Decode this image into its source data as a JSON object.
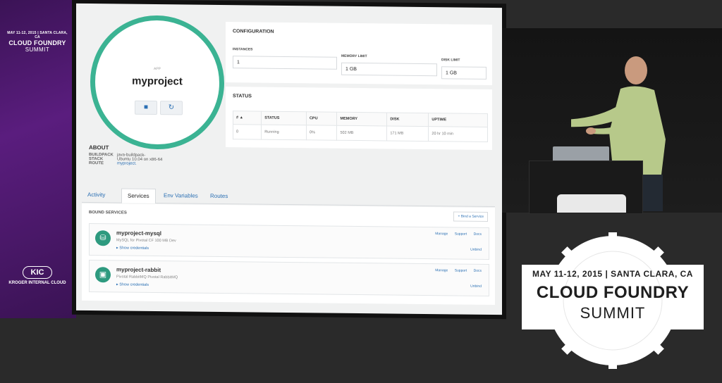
{
  "banner": {
    "date": "MAY 11-12, 2015 | SANTA CLARA, CA",
    "brand": "CLOUD FOUNDRY",
    "event": "SUMMIT",
    "kic_mark": "KIC",
    "kic_name": "KROGER INTERNAL CLOUD"
  },
  "app": {
    "label": "APP",
    "name": "myproject"
  },
  "about": {
    "heading": "ABOUT",
    "buildpack_label": "BUILDPACK",
    "buildpack_value": "java-buildpack-",
    "stack_label": "STACK",
    "stack_value": "Ubuntu 10.04 on x86-64",
    "route_label": "ROUTE",
    "route_value": "myproject."
  },
  "configuration": {
    "heading": "CONFIGURATION",
    "instances_label": "INSTANCES",
    "instances_value": "1",
    "memory_label": "MEMORY LIMIT",
    "memory_value": "1 GB",
    "disk_label": "DISK LIMIT",
    "disk_value": "1 GB"
  },
  "status": {
    "heading": "STATUS",
    "columns": [
      "# ▲",
      "STATUS",
      "CPU",
      "MEMORY",
      "DISK",
      "UPTIME"
    ],
    "rows": [
      [
        "0",
        "Running",
        "0%",
        "502 MB",
        "171 MB",
        "20 hr 10 min"
      ]
    ]
  },
  "tabs": [
    "Activity",
    "Services",
    "Env Variables",
    "Routes"
  ],
  "bound_services": {
    "heading": "BOUND SERVICES",
    "bind_label": "+ Bind a Service",
    "items": [
      {
        "name": "myproject-mysql",
        "plan": "MySQL for Pivotal CF 100 MB Dev",
        "show_credentials": "▸ Show credentials",
        "manage": "Manage",
        "support": "Support",
        "docs": "Docs",
        "unbind": "Unbind"
      },
      {
        "name": "myproject-rabbit",
        "plan": "Pivotal RabbitMQ Pivotal RabbitMQ",
        "show_credentials": "▸ Show credentials",
        "manage": "Manage",
        "support": "Support",
        "docs": "Docs",
        "unbind": "Unbind"
      }
    ]
  },
  "summit_badge": {
    "date": "MAY 11-12, 2015  |  SANTA CLARA, CA",
    "brand": "CLOUD FOUNDRY",
    "event": "SUMMIT"
  }
}
